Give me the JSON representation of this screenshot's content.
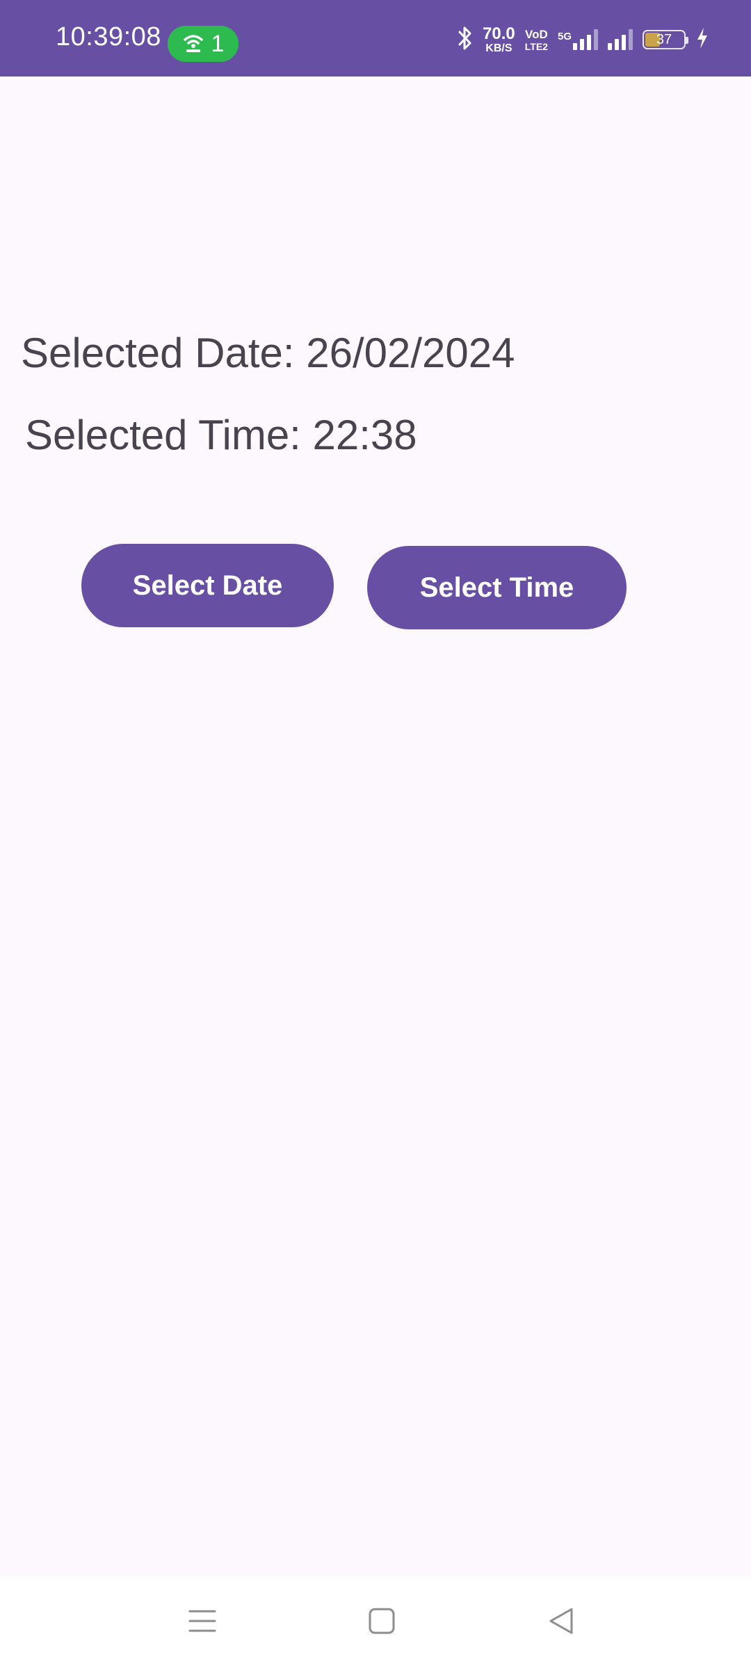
{
  "status_bar": {
    "time": "10:39:08",
    "hotspot_count": "1",
    "net_speed_value": "70.0",
    "net_speed_unit": "KB/S",
    "volte_top": "VoD",
    "volte_bottom": "LTE2",
    "net_type": "5G",
    "battery_level": "37",
    "background_color": "#6750a4",
    "hotspot_color": "#2dbb4f",
    "icons": [
      "hotspot-icon",
      "bluetooth-icon",
      "signal-icon",
      "battery-icon",
      "charging-icon"
    ]
  },
  "main": {
    "selected_date_text": "Selected Date: 26/02/2024",
    "selected_time_text": "Selected Time: 22:38",
    "select_date_button": "Select Date",
    "select_time_button": "Select Time",
    "accent_color": "#6750a4",
    "background_color": "#fdf7fe"
  },
  "nav_bar": {
    "icons": [
      "menu-icon",
      "home-icon",
      "back-icon"
    ]
  }
}
